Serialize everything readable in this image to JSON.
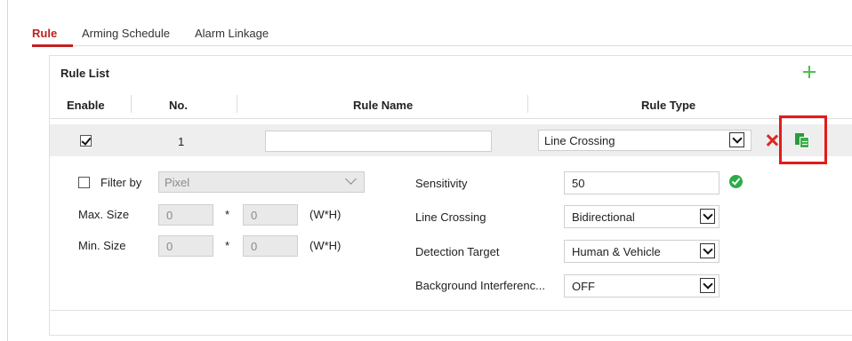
{
  "tabs": [
    {
      "label": "Rule",
      "active": true
    },
    {
      "label": "Arming Schedule",
      "active": false
    },
    {
      "label": "Alarm Linkage",
      "active": false
    }
  ],
  "rule_list": {
    "title": "Rule List",
    "columns": {
      "enable": "Enable",
      "no": "No.",
      "rule_name": "Rule Name",
      "rule_type": "Rule Type"
    },
    "rows": [
      {
        "enabled": true,
        "no": "1",
        "rule_name": "",
        "rule_type": "Line Crossing"
      }
    ]
  },
  "filter": {
    "checkbox_label": "Filter by",
    "checked": false,
    "unit_value": "Pixel",
    "max_size_label": "Max. Size",
    "max_w": "0",
    "max_h": "0",
    "min_size_label": "Min. Size",
    "min_w": "0",
    "min_h": "0",
    "times": "*",
    "dims": "(W*H)"
  },
  "settings": {
    "sensitivity_label": "Sensitivity",
    "sensitivity_value": "50",
    "line_crossing_label": "Line Crossing",
    "line_crossing_value": "Bidirectional",
    "detection_target_label": "Detection Target",
    "detection_target_value": "Human & Vehicle",
    "background_label": "Background Interferenc...",
    "background_value": "OFF"
  },
  "icons": {
    "add": "plus-icon",
    "delete": "close-icon",
    "copy": "copy-icon",
    "valid": "check-circle-icon"
  },
  "colors": {
    "accent": "#c41e1e",
    "add_green": "#4cbf4c",
    "copy_green": "#3cb04a",
    "delete_red": "#e02626",
    "highlight_red": "#e21b1b"
  }
}
